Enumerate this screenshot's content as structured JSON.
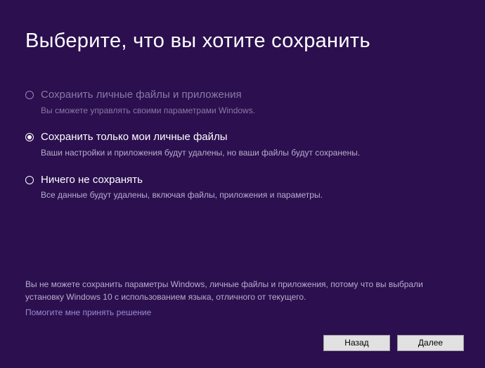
{
  "title": "Выберите, что вы хотите сохранить",
  "options": [
    {
      "label": "Сохранить личные файлы и приложения",
      "description": "Вы сможете управлять своими параметрами Windows.",
      "selected": false,
      "disabled": true
    },
    {
      "label": "Сохранить только мои личные файлы",
      "description": "Ваши настройки и приложения будут удалены, но ваши файлы будут сохранены.",
      "selected": true,
      "disabled": false
    },
    {
      "label": "Ничего не сохранять",
      "description": "Все данные будут удалены, включая файлы, приложения и параметры.",
      "selected": false,
      "disabled": false
    }
  ],
  "info_text": "Вы не можете сохранить параметры Windows, личные файлы и приложения, потому что вы выбрали установку Windows 10 с использованием языка, отличного от текущего.",
  "help_link": "Помогите мне принять решение",
  "buttons": {
    "back": "Назад",
    "next": "Далее"
  }
}
